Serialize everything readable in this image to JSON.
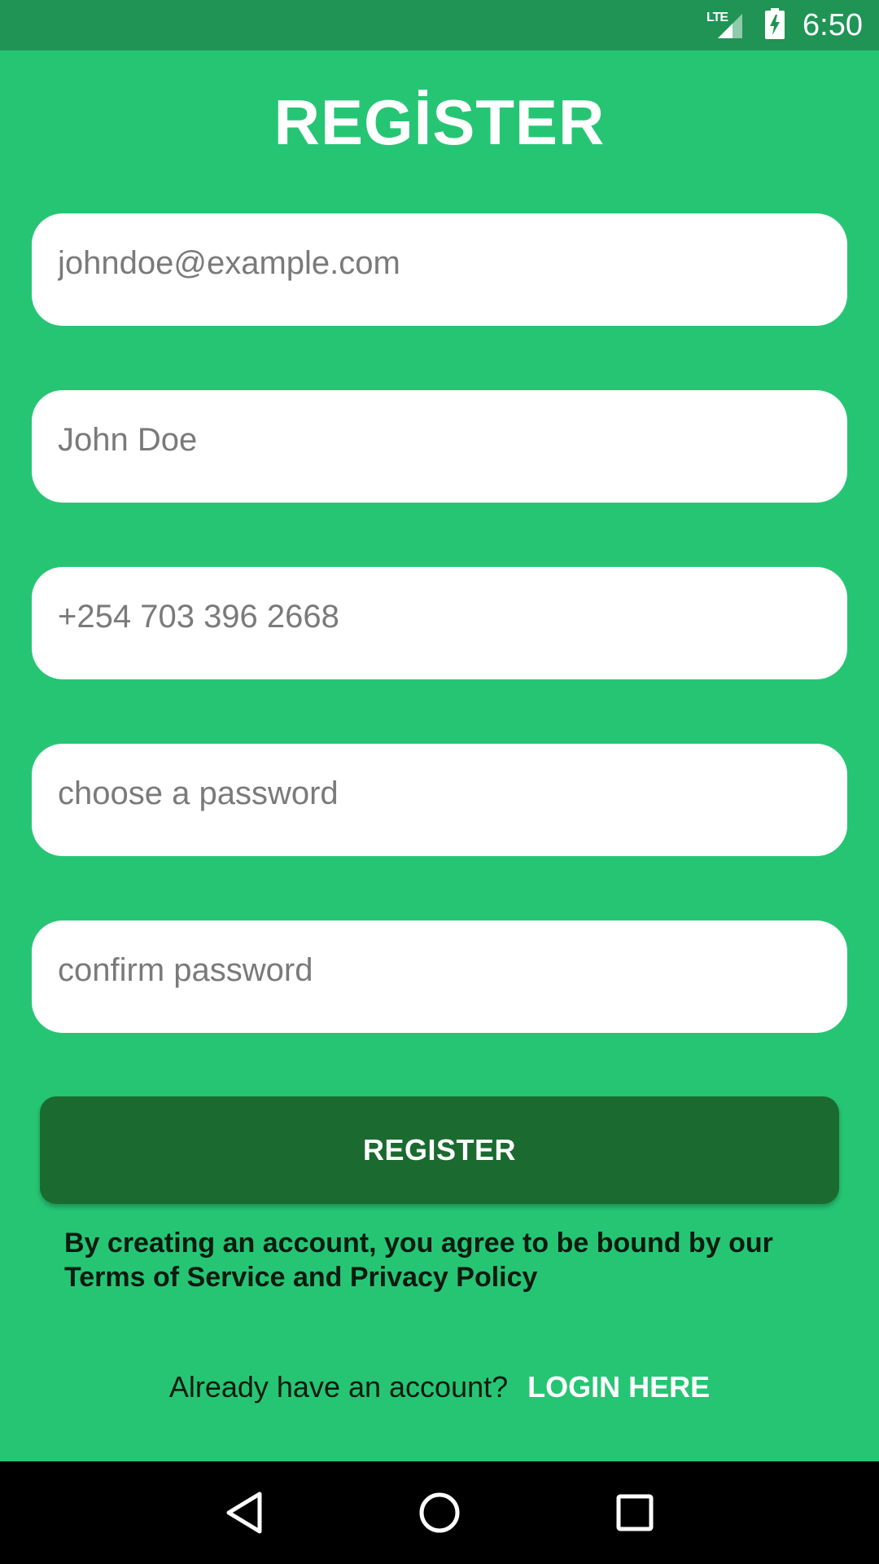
{
  "status_bar": {
    "network_label": "LTE",
    "time": "6:50"
  },
  "title": "REGİSTER",
  "form": {
    "email_placeholder": "johndoe@example.com",
    "name_placeholder": "John Doe",
    "phone_placeholder": "+254 703 396 2668",
    "password_placeholder": "choose a password",
    "confirm_password_placeholder": "confirm password"
  },
  "register_button_label": "REGISTER",
  "terms_text": "By creating an account, you agree to be bound by our Terms of Service and Privacy Policy",
  "login_prompt": {
    "question": "Already have an account?",
    "link_label": "LOGIN HERE"
  },
  "colors": {
    "background": "#26c574",
    "status_bar": "#1f9455",
    "button": "#1b6a30",
    "field": "#ffffff"
  },
  "icons": {
    "nav_back": "back-triangle-icon",
    "nav_home": "home-circle-icon",
    "nav_recents": "recents-square-icon"
  }
}
